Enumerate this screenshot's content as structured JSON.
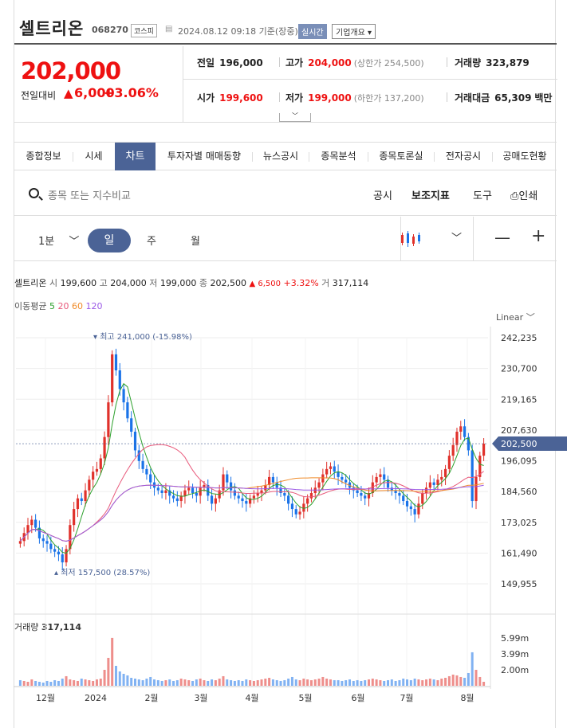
{
  "header": {
    "name": "셀트리온",
    "code": "068270",
    "market": "코스피",
    "datetime": "2024.08.12 09:18 기준(장중)",
    "realtime": "실시간",
    "overview": "기업개요"
  },
  "price": {
    "current": "202,000",
    "change_label": "전일대비",
    "change_symbol": "▲",
    "change": "6,000",
    "change_pct": "+3.06%"
  },
  "stats": {
    "prev_label": "전일",
    "prev": "196,000",
    "high_label": "고가",
    "high": "204,000",
    "upper_limit": "(상한가 254,500)",
    "vol_label": "거래량",
    "vol": "323,879",
    "open_label": "시가",
    "open": "199,600",
    "low_label": "저가",
    "low": "199,000",
    "lower_limit": "(하한가 137,200)",
    "amount_label": "거래대금",
    "amount": "65,309",
    "amount_unit": "백만"
  },
  "tabs": [
    "종합정보",
    "시세",
    "차트",
    "투자자별 매매동향",
    "뉴스공시",
    "종목분석",
    "종목토론실",
    "전자공시",
    "공매도현황"
  ],
  "active_tab": "차트",
  "toolbar": {
    "search_placeholder": "종목 또는 지수비교",
    "notice": "공시",
    "indicator": "보조지표",
    "tools": "도구",
    "print": "인쇄"
  },
  "periods": {
    "minute": "1분",
    "day": "일",
    "week": "주",
    "month": "월"
  },
  "chart_info": {
    "name": "셀트리온",
    "open_label": "시",
    "open": "199,600",
    "high_label": "고",
    "high": "204,000",
    "low_label": "저",
    "low": "199,000",
    "close_label": "종",
    "close": "202,500",
    "change": "▲ 6,500",
    "change_pct": "+3.32%",
    "vol_label": "거",
    "vol": "317,114"
  },
  "ma": {
    "label": "이동평균",
    "p5": "5",
    "p20": "20",
    "p60": "60",
    "p120": "120",
    "colors": {
      "p5": "#2ca02c",
      "p20": "#e8587a",
      "p60": "#f08c2a",
      "p120": "#9b59e6"
    }
  },
  "scale_mode": "Linear",
  "colors": {
    "up": "#e0312b",
    "down": "#1a73e8",
    "accent": "#4b6396"
  },
  "chart_data": {
    "type": "candlestick",
    "y_ticks": [
      "242,235",
      "230,700",
      "219,165",
      "207,630",
      "196,095",
      "184,560",
      "173,025",
      "161,490",
      "149,955"
    ],
    "ylim": [
      149955,
      242235
    ],
    "current_price_label": "202,500",
    "x_ticks": [
      "12월",
      "2024",
      "2월",
      "3월",
      "4월",
      "5월",
      "6월",
      "7월",
      "8월"
    ],
    "max_annotation": "최고 241,000 (-15.98%)",
    "min_annotation": "최저 157,500 (28.57%)",
    "close_series": [
      166000,
      169000,
      172000,
      174000,
      171000,
      167000,
      166000,
      165000,
      163000,
      162000,
      161000,
      158000,
      163000,
      172000,
      178000,
      182000,
      181000,
      185000,
      189000,
      192000,
      193000,
      197000,
      205000,
      218000,
      236000,
      230000,
      223000,
      218000,
      212000,
      207000,
      200000,
      196000,
      193000,
      191000,
      188000,
      186000,
      185000,
      184000,
      185000,
      183000,
      182000,
      181000,
      183000,
      185000,
      186000,
      184000,
      183000,
      186000,
      187000,
      183000,
      180000,
      182000,
      185000,
      191000,
      188000,
      185000,
      183000,
      182000,
      181000,
      180000,
      182000,
      183000,
      184000,
      185000,
      187000,
      190000,
      188000,
      186000,
      184000,
      183000,
      180000,
      178000,
      176000,
      177000,
      180000,
      182000,
      184000,
      186000,
      188000,
      191000,
      193000,
      194000,
      192000,
      190000,
      189000,
      188000,
      186000,
      185000,
      184000,
      183000,
      182000,
      184000,
      188000,
      190000,
      191000,
      189000,
      186000,
      185000,
      184000,
      183000,
      181000,
      179000,
      178000,
      176000,
      180000,
      184000,
      186000,
      188000,
      187000,
      189000,
      190000,
      193000,
      198000,
      202000,
      207000,
      209000,
      205000,
      200000,
      181000,
      190000,
      198000,
      202500
    ],
    "volume": {
      "label": "거래량",
      "value": "317,114",
      "y_ticks": [
        "5.99m",
        "3.99m",
        "2.00m"
      ],
      "series": [
        0.7,
        0.6,
        0.5,
        0.8,
        0.6,
        0.5,
        0.4,
        0.6,
        0.5,
        0.7,
        0.6,
        0.9,
        1.2,
        0.8,
        0.7,
        0.6,
        0.9,
        0.8,
        0.7,
        0.6,
        0.8,
        0.9,
        2.0,
        3.5,
        6.0,
        2.5,
        1.8,
        1.5,
        1.3,
        1.0,
        0.9,
        0.8,
        0.7,
        0.9,
        1.1,
        0.8,
        0.7,
        0.6,
        0.7,
        0.8,
        0.6,
        0.7,
        0.9,
        0.8,
        0.7,
        0.6,
        0.8,
        0.9,
        0.7,
        0.6,
        0.8,
        0.7,
        0.9,
        1.2,
        0.8,
        0.7,
        0.6,
        0.7,
        0.6,
        0.8,
        0.7,
        0.6,
        0.7,
        0.8,
        0.9,
        1.0,
        0.8,
        0.7,
        0.6,
        0.7,
        0.9,
        1.1,
        0.8,
        0.7,
        0.9,
        0.8,
        0.7,
        0.8,
        0.9,
        1.1,
        0.9,
        0.8,
        0.7,
        0.7,
        0.6,
        0.7,
        0.8,
        0.6,
        0.7,
        0.6,
        0.7,
        0.8,
        0.9,
        0.8,
        0.7,
        0.6,
        0.7,
        0.8,
        0.6,
        0.7,
        0.9,
        0.8,
        0.7,
        0.9,
        0.8,
        0.7,
        0.8,
        0.9,
        0.8,
        0.7,
        0.9,
        1.0,
        1.2,
        1.4,
        1.3,
        1.1,
        1.0,
        1.6,
        4.2,
        2.0,
        1.1,
        0.5
      ]
    }
  }
}
